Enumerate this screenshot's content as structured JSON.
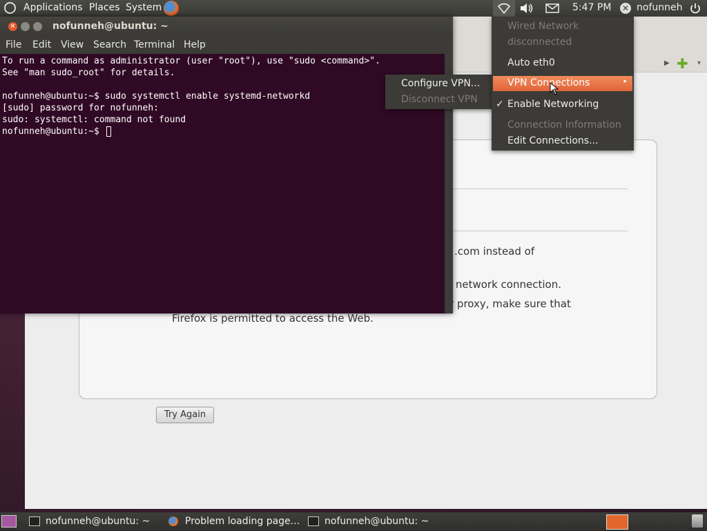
{
  "top_panel": {
    "menus": [
      "Applications",
      "Places",
      "System"
    ],
    "clock": "5:47 PM",
    "user": "nofunneh"
  },
  "firefox": {
    "error_lines": [
      ".com instead of",
      "r's network connection.",
      "r proxy, make sure that",
      "Firefox is permitted to access the Web."
    ],
    "try_again": "Try Again"
  },
  "terminal": {
    "title": "nofunneh@ubuntu: ~",
    "menu": [
      "File",
      "Edit",
      "View",
      "Search",
      "Terminal",
      "Help"
    ],
    "lines": [
      "To run a command as administrator (user \"root\"), use \"sudo <command>\".",
      "See \"man sudo_root\" for details.",
      "",
      "nofunneh@ubuntu:~$ sudo systemctl enable systemd-networkd",
      "[sudo] password for nofunneh:",
      "sudo: systemctl: command not found",
      "nofunneh@ubuntu:~$ "
    ]
  },
  "network_menu": {
    "wired_header": "Wired Network",
    "wired_status": "disconnected",
    "auto_eth0": "Auto eth0",
    "vpn_connections": "VPN Connections",
    "enable_networking": "Enable Networking",
    "connection_information": "Connection Information",
    "edit_connections": "Edit Connections..."
  },
  "vpn_submenu": {
    "configure": "Configure VPN...",
    "disconnect": "Disconnect VPN"
  },
  "taskbar": {
    "items": [
      "nofunneh@ubuntu: ~",
      "Problem loading page...",
      "nofunneh@ubuntu: ~"
    ]
  },
  "colors": {
    "terminal_bg": "#300a24",
    "highlight": "#e8703f",
    "panel": "#3c3b37"
  }
}
